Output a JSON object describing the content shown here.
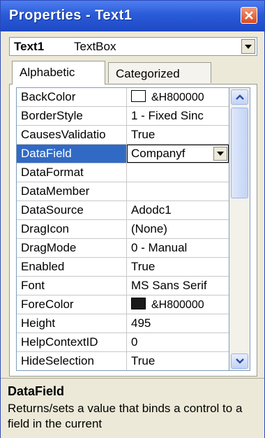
{
  "window": {
    "title": "Properties - Text1"
  },
  "object_selector": {
    "name": "Text1",
    "type": "TextBox"
  },
  "tabs": [
    {
      "label": "Alphabetic",
      "active": true
    },
    {
      "label": "Categorized",
      "active": false
    }
  ],
  "properties": [
    {
      "name": "BackColor",
      "value": "&H800000",
      "swatch": "#ffffff"
    },
    {
      "name": "BorderStyle",
      "value": "1 - Fixed Sinc"
    },
    {
      "name": "CausesValidatio",
      "value": "True"
    },
    {
      "name": "DataField",
      "value": "Companyf",
      "selected": true
    },
    {
      "name": "DataFormat",
      "value": ""
    },
    {
      "name": "DataMember",
      "value": ""
    },
    {
      "name": "DataSource",
      "value": "Adodc1"
    },
    {
      "name": "DragIcon",
      "value": "(None)"
    },
    {
      "name": "DragMode",
      "value": "0 - Manual"
    },
    {
      "name": "Enabled",
      "value": "True"
    },
    {
      "name": "Font",
      "value": "MS Sans Serif"
    },
    {
      "name": "ForeColor",
      "value": "&H800000",
      "swatch": "#1a1a1a"
    },
    {
      "name": "Height",
      "value": "495"
    },
    {
      "name": "HelpContextID",
      "value": "0"
    },
    {
      "name": "HideSelection",
      "value": "True"
    }
  ],
  "description": {
    "title": "DataField",
    "text": "Returns/sets a value that binds a control to a field in the current"
  },
  "colors": {
    "titlebar": "#2a5bd8",
    "selection": "#316ac5",
    "close_button": "#d9481f"
  }
}
